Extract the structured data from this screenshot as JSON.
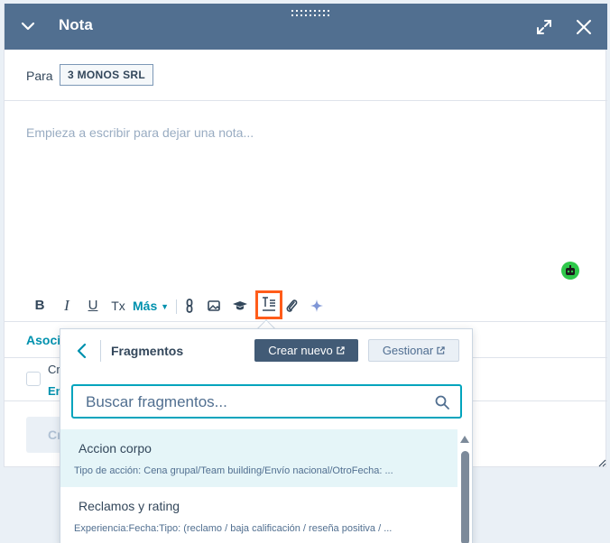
{
  "header": {
    "title": "Nota"
  },
  "recipient": {
    "label": "Para",
    "tag": "3 MONOS SRL"
  },
  "editor": {
    "placeholder": "Empieza a escribir para dejar una nota..."
  },
  "toolbar": {
    "bold": "B",
    "italic": "I",
    "underline": "U",
    "clear": "Tx",
    "more": "Más"
  },
  "associations": {
    "label": "Asoci"
  },
  "task": {
    "line1": "Cr",
    "line2": "En"
  },
  "footer": {
    "create_label": "Cr"
  },
  "snippets": {
    "title": "Fragmentos",
    "create_new": "Crear nuevo",
    "manage": "Gestionar",
    "search_placeholder": "Buscar fragmentos...",
    "items": [
      {
        "name": "Accion corpo",
        "desc": "Tipo de acción: Cena grupal/Team building/Envío nacional/OtroFecha: ..."
      },
      {
        "name": "Reclamos y rating",
        "desc": "Experiencia:Fecha:Tipo: (reclamo / baja calificación / reseña positiva / ..."
      }
    ]
  },
  "colors": {
    "header_bg": "#516f90",
    "accent": "#0091ae",
    "highlight": "#ff5c1a",
    "focus": "#00a4bd"
  }
}
